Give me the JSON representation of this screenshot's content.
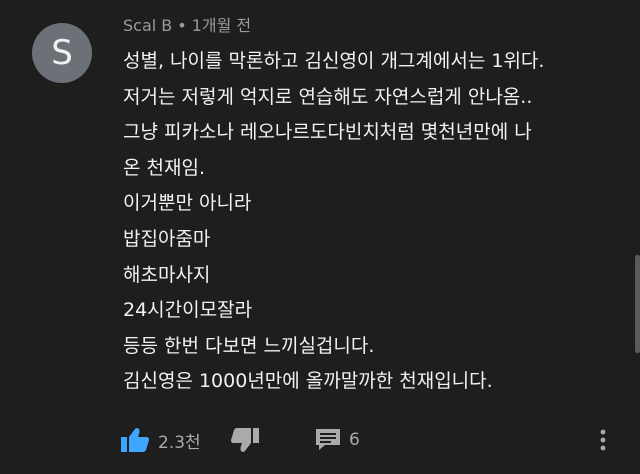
{
  "comment": {
    "avatar_letter": "S",
    "author": "Scal B",
    "separator": "•",
    "time": "1개월 전",
    "lines": [
      "성별, 나이를 막론하고 김신영이 개그계에서는 1위다.",
      "저거는 저렇게 억지로 연습해도 자연스럽게 안나옴..",
      "그냥 피카소나 레오나르도다빈치처럼 몇천년만에 나",
      "온 천재임.",
      "이거뿐만 아니라",
      "밥집아줌마",
      "해초마사지",
      "24시간이모잘라",
      "등등 한번 다보면 느끼실겁니다.",
      "김신영은 1000년만에 올까말까한 천재입니다."
    ],
    "like_count": "2.3천",
    "reply_count": "6"
  },
  "icons": {
    "like": "thumbs-up-icon",
    "dislike": "thumbs-down-icon",
    "reply": "comment-icon",
    "more": "more-vertical-icon"
  },
  "colors": {
    "background": "#1e1e1e",
    "text": "#f1f1f1",
    "meta": "#9a9a9a",
    "like_active": "#3ea6ff",
    "icon": "#aaaaaa",
    "avatar": "#6c7178"
  }
}
